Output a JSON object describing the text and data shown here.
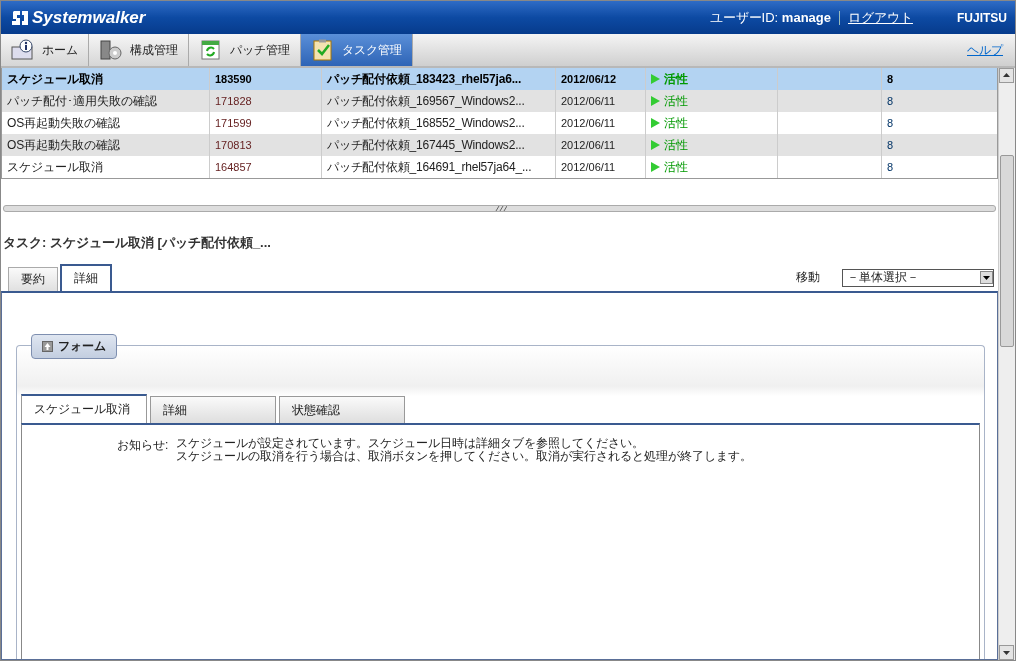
{
  "header": {
    "logo": "Systemwalker",
    "user_label": "ユーザーID:",
    "user_id": "manage",
    "logout": "ログアウト",
    "brand": "FUJITSU"
  },
  "nav": {
    "items": [
      {
        "label": "ホーム",
        "kind": "home",
        "selected": false
      },
      {
        "label": "構成管理",
        "kind": "config",
        "selected": false
      },
      {
        "label": "パッチ管理",
        "kind": "patch",
        "selected": false
      },
      {
        "label": "タスク管理",
        "kind": "task",
        "selected": true
      }
    ],
    "help": "ヘルプ"
  },
  "table": {
    "rows": [
      {
        "cells": [
          "スケジュール取消",
          "183590",
          "パッチ配付依頼_183423_rhel57ja6...",
          "2012/06/12"
        ],
        "status": "活性",
        "count": "8",
        "selected": true
      },
      {
        "cells": [
          "パッチ配付･適用失敗の確認",
          "171828",
          "パッチ配付依頼_169567_Windows2...",
          "2012/06/11"
        ],
        "status": "活性",
        "count": "8",
        "selected": false
      },
      {
        "cells": [
          "OS再起動失敗の確認",
          "171599",
          "パッチ配付依頼_168552_Windows2...",
          "2012/06/11"
        ],
        "status": "活性",
        "count": "8",
        "selected": false
      },
      {
        "cells": [
          "OS再起動失敗の確認",
          "170813",
          "パッチ配付依頼_167445_Windows2...",
          "2012/06/11"
        ],
        "status": "活性",
        "count": "8",
        "selected": false
      },
      {
        "cells": [
          "スケジュール取消",
          "164857",
          "パッチ配付依頼_164691_rhel57ja64_...",
          "2012/06/11"
        ],
        "status": "活性",
        "count": "8",
        "selected": false
      }
    ]
  },
  "detail": {
    "title": "タスク: スケジュール取消 [パッチ配付依頼_...",
    "tabs": [
      {
        "label": "要約",
        "selected": false
      },
      {
        "label": "詳細",
        "selected": true
      }
    ],
    "move_label": "移動",
    "move_value": "－単体選択－",
    "form": {
      "legend": "フォーム",
      "tabs": [
        {
          "label": "スケジュール取消",
          "selected": true
        },
        {
          "label": "詳細",
          "selected": false
        },
        {
          "label": "状態確認",
          "selected": false
        }
      ],
      "notice_label": "お知らせ:",
      "notice_lines": [
        "スケジュールが設定されています。スケジュール日時は詳細タブを参照してください。",
        "スケジュールの取消を行う場合は、取消ボタンを押してください。取消が実行されると処理が終了します。"
      ]
    }
  }
}
